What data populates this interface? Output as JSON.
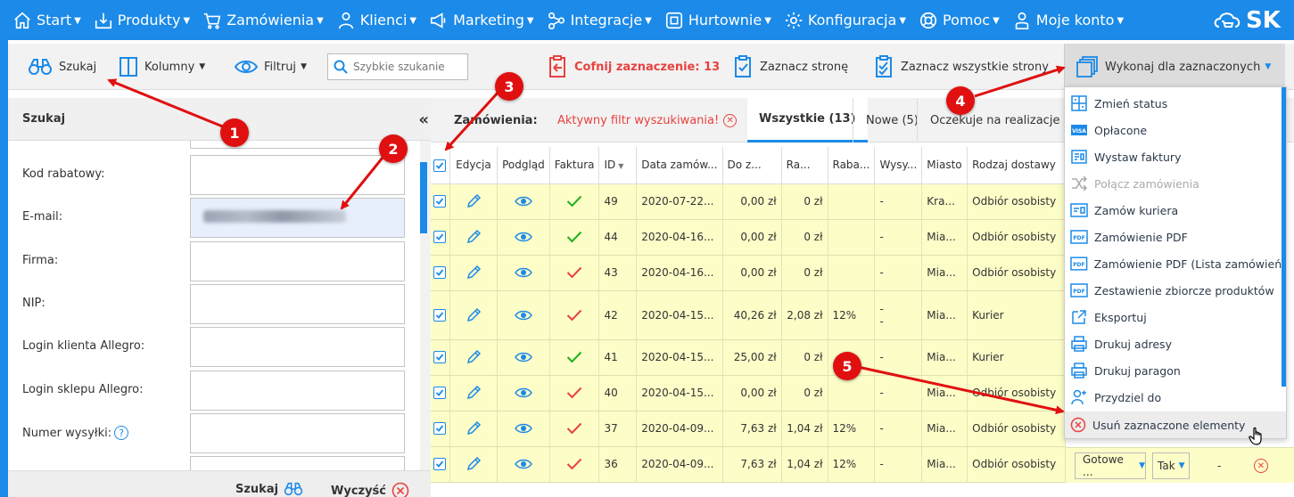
{
  "nav": {
    "items": [
      {
        "label": "Start",
        "icon": "home-icon"
      },
      {
        "label": "Produkty",
        "icon": "box-icon"
      },
      {
        "label": "Zamówienia",
        "icon": "cart-icon"
      },
      {
        "label": "Klienci",
        "icon": "user-icon"
      },
      {
        "label": "Marketing",
        "icon": "megaphone-icon"
      },
      {
        "label": "Integracje",
        "icon": "share-icon"
      },
      {
        "label": "Hurtownie",
        "icon": "cube-icon"
      },
      {
        "label": "Konfiguracja",
        "icon": "gear-icon"
      },
      {
        "label": "Pomoc",
        "icon": "lifebuoy-icon"
      },
      {
        "label": "Moje konto",
        "icon": "account-icon"
      }
    ],
    "logo_text": "SK"
  },
  "toolbar": {
    "search_label": "Szukaj",
    "columns_label": "Kolumny",
    "filter_label": "Filtruj",
    "quick_search_placeholder": "Szybkie szukanie",
    "undo_selection_label": "Cofnij zaznaczenie: 13",
    "select_page_label": "Zaznacz stronę",
    "select_all_label": "Zaznacz wszystkie strony",
    "execute_label": "Wykonaj dla zaznaczonych"
  },
  "left_panel": {
    "title": "Szukaj",
    "collapse": "«",
    "fields": [
      {
        "label": "Kod rabatowy:",
        "value": ""
      },
      {
        "label": "E-mail:",
        "value": ""
      },
      {
        "label": "Firma:",
        "value": ""
      },
      {
        "label": "NIP:",
        "value": ""
      },
      {
        "label": "Login klienta Allegro:",
        "value": ""
      },
      {
        "label": "Login sklepu Allegro:",
        "value": ""
      },
      {
        "label": "Numer wysyłki:",
        "value": ""
      }
    ],
    "help": "?",
    "search_button": "Szukaj",
    "clear_button": "Wyczyść"
  },
  "tabs": {
    "label": "Zamówienia:",
    "filter_notice": "Aktywny filtr wyszukiwania!",
    "filter_close": "⊗",
    "items": [
      {
        "label": "Wszystkie (13)"
      },
      {
        "label": "Nowe (5)"
      },
      {
        "label": "Oczekuje na realizacje"
      }
    ]
  },
  "table": {
    "headers": [
      "Edycja",
      "Podgląd",
      "Faktura",
      "ID",
      "Data zamów...",
      "Do z...",
      "Ra...",
      "Raba...",
      "Wysy...",
      "Miasto",
      "Rodzaj dostawy"
    ],
    "rows": [
      {
        "id": "49",
        "date": "2020-07-22...",
        "amount": "0,00 zł",
        "rabat": "0 zł",
        "rabat_pct": "",
        "wysylka": "-",
        "city": "Kra...",
        "delivery": "Odbiór osobisty",
        "invoice": "green"
      },
      {
        "id": "44",
        "date": "2020-04-16...",
        "amount": "0,00 zł",
        "rabat": "0 zł",
        "rabat_pct": "",
        "wysylka": "-",
        "city": "Mia...",
        "delivery": "Odbiór osobisty",
        "invoice": "green"
      },
      {
        "id": "43",
        "date": "2020-04-16...",
        "amount": "0,00 zł",
        "rabat": "0 zł",
        "rabat_pct": "",
        "wysylka": "-",
        "city": "Mia...",
        "delivery": "Odbiór osobisty",
        "invoice": "red"
      },
      {
        "id": "42",
        "date": "2020-04-15...",
        "amount": "40,26 zł",
        "rabat": "2,08 zł",
        "rabat_pct": "12%",
        "wysylka": "- -",
        "city": "Mia...",
        "delivery": "Kurier",
        "invoice": "red"
      },
      {
        "id": "41",
        "date": "2020-04-15...",
        "amount": "25,00 zł",
        "rabat": "0 zł",
        "rabat_pct": "",
        "wysylka": "-",
        "city": "Mia...",
        "delivery": "Kurier",
        "invoice": "green"
      },
      {
        "id": "40",
        "date": "2020-04-15...",
        "amount": "0,00 zł",
        "rabat": "0 zł",
        "rabat_pct": "",
        "wysylka": "-",
        "city": "Mia...",
        "delivery": "Odbiór osobisty",
        "invoice": "red"
      },
      {
        "id": "37",
        "date": "2020-04-09...",
        "amount": "7,63 zł",
        "rabat": "1,04 zł",
        "rabat_pct": "12%",
        "wysylka": "-",
        "city": "Mia...",
        "delivery": "Odbiór osobisty",
        "invoice": "red"
      },
      {
        "id": "36",
        "date": "2020-04-09...",
        "amount": "7,63 zł",
        "rabat": "1,04 zł",
        "rabat_pct": "12%",
        "wysylka": "-",
        "city": "Mia...",
        "delivery": "Odbiór osobisty",
        "invoice": "red"
      }
    ],
    "last_row_extra": {
      "status": "Gotowe ...",
      "paid": "Tak",
      "dash": "-"
    }
  },
  "dropdown": {
    "items": [
      {
        "label": "Zmień status",
        "icon": "status-icon"
      },
      {
        "label": "Opłacone",
        "icon": "card-icon"
      },
      {
        "label": "Wystaw faktury",
        "icon": "invoice-icon"
      },
      {
        "label": "Połącz zamówienia",
        "icon": "merge-icon",
        "disabled": true
      },
      {
        "label": "Zamów kuriera",
        "icon": "courier-icon"
      },
      {
        "label": "Zamówienie PDF",
        "icon": "pdf-icon"
      },
      {
        "label": "Zamówienie PDF (Lista zamówień)",
        "icon": "pdf-icon"
      },
      {
        "label": "Zestawienie zbiorcze produktów",
        "icon": "summary-icon"
      },
      {
        "label": "Eksportuj",
        "icon": "export-icon"
      },
      {
        "label": "Drukuj adresy",
        "icon": "printer-icon"
      },
      {
        "label": "Drukuj paragon",
        "icon": "printer-icon"
      },
      {
        "label": "Przydziel do",
        "icon": "assign-icon"
      },
      {
        "label": "Usuń zaznaczone elementy",
        "icon": "delete-icon"
      }
    ]
  },
  "annotations": [
    "1",
    "2",
    "3",
    "4",
    "5"
  ],
  "colors": {
    "brand": "#1b8ae8",
    "row": "#fdfdc8",
    "danger": "#e8423f",
    "annotation": "#e01010"
  }
}
